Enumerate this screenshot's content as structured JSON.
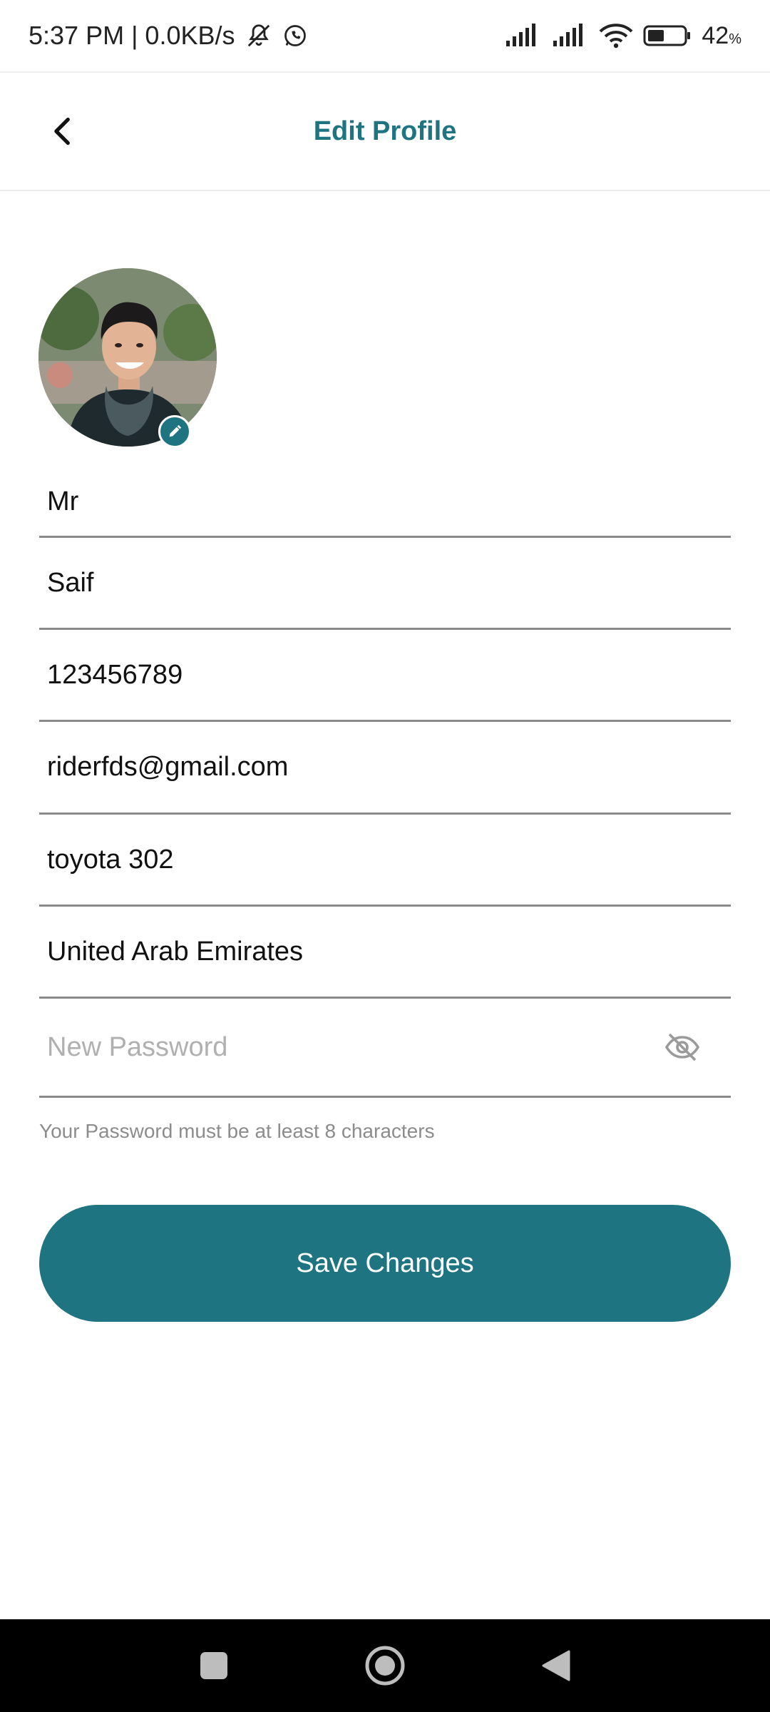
{
  "status_bar": {
    "time_and_speed": "5:37 PM | 0.0KB/s",
    "battery_percent": "42",
    "battery_unit": "%"
  },
  "app_bar": {
    "title": "Edit Profile"
  },
  "avatar": {
    "icon": "pencil-icon"
  },
  "form": {
    "title_value": "Mr",
    "name_value": "Saif",
    "phone_value": "123456789",
    "email_value": "riderfds@gmail.com",
    "vehicle_value": "toyota 302",
    "country_value": "United Arab Emirates",
    "password_placeholder": "New Password",
    "password_helper": "Your Password must be at least 8 characters",
    "save_label": "Save Changes"
  },
  "colors": {
    "accent": "#1f7482",
    "divider": "#8a8a8a",
    "helper_text": "#8c8c8c"
  }
}
